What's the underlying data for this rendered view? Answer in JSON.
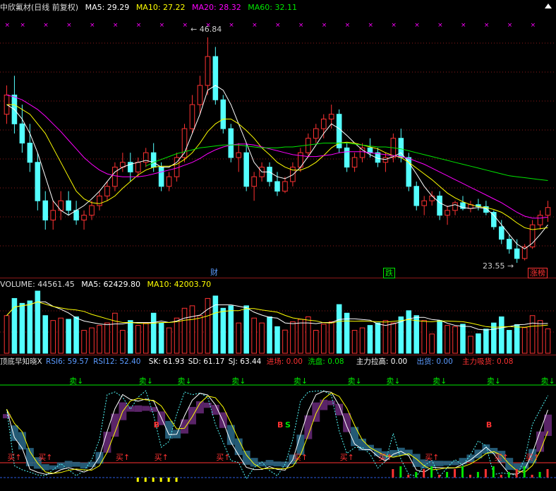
{
  "header": {
    "title": "中欣氟材(日线 前复权)",
    "ma5": "MA5: 29.29",
    "ma10": "MA10: 27.22",
    "ma20": "MA20: 28.32",
    "ma60": "MA60: 32.11"
  },
  "volume_header": {
    "label": "VOLUME: 44561.45",
    "ma5": "MA5: 62429.80",
    "ma10": "MA10: 42003.70"
  },
  "indicator_header": {
    "name": "顶底早知晓X",
    "rsi6": "RSI6: 59.57",
    "rsi12": "RSI12: 52.40",
    "sk": "SK: 61.93",
    "sd": "SD: 61.17",
    "sj": "SJ: 63.44",
    "jinchang": "进场: 0.00",
    "xipan": "洗盘: 0.08",
    "lagao": "主力拉高: 0.00",
    "chuhuo": "出货: 0.00",
    "xihuo": "主力吸货: 0.08"
  },
  "markers": {
    "high_label": "46.84",
    "low_label": "23.55",
    "cai": "财",
    "die": "跌",
    "zhangting": "涨榜",
    "sell": "卖",
    "buy": "买",
    "b_label": "B",
    "s_label": "S",
    "up_arrow": "↑",
    "down_arrow": "↓"
  },
  "colors": {
    "up": "#ff3232",
    "down": "#54ffff",
    "ma5": "#ffffff",
    "ma10": "#ffff00",
    "ma20": "#ff00ff",
    "ma60": "#00e600",
    "grid": "#8b1a1a",
    "purple_area": "#6a2a7a",
    "blue_area": "#2a6a8a"
  },
  "chart_data": {
    "type": "candlestick",
    "title": "中欣氟材(日线 前复权)",
    "price_high": 46.84,
    "price_low": 23.55,
    "candles": [
      [
        39,
        42,
        38,
        41
      ],
      [
        41,
        43,
        37,
        38
      ],
      [
        38,
        40,
        35,
        36
      ],
      [
        36,
        38,
        33,
        34
      ],
      [
        34,
        35,
        29,
        30
      ],
      [
        30,
        31,
        27,
        28
      ],
      [
        28,
        30,
        27,
        29
      ],
      [
        29,
        31,
        28,
        30
      ],
      [
        30,
        31,
        28.5,
        29
      ],
      [
        29,
        30,
        27.5,
        28
      ],
      [
        28,
        29,
        27,
        28.5
      ],
      [
        28.5,
        30,
        28,
        29.5
      ],
      [
        29.5,
        31,
        29,
        30.5
      ],
      [
        30.5,
        32,
        30,
        31.5
      ],
      [
        31.5,
        34,
        31,
        33.5
      ],
      [
        33.5,
        35,
        33,
        34
      ],
      [
        34,
        35,
        32,
        33
      ],
      [
        33,
        34.5,
        32.5,
        34
      ],
      [
        34,
        35.5,
        33.5,
        35
      ],
      [
        35,
        36,
        33,
        33.5
      ],
      [
        33.5,
        34,
        31,
        31.5
      ],
      [
        31.5,
        33,
        31,
        32.5
      ],
      [
        32.5,
        35,
        32,
        34.5
      ],
      [
        34.5,
        38,
        34,
        37.5
      ],
      [
        37.5,
        41,
        37,
        40
      ],
      [
        40,
        43,
        39,
        42
      ],
      [
        42,
        47,
        41,
        45
      ],
      [
        45,
        46,
        40,
        40.5
      ],
      [
        40.5,
        41,
        37,
        37.5
      ],
      [
        37.5,
        38,
        34,
        34.5
      ],
      [
        34.5,
        36,
        33,
        35
      ],
      [
        35,
        36,
        31,
        31.5
      ],
      [
        31.5,
        33,
        30,
        32.5
      ],
      [
        32.5,
        34,
        32,
        33.5
      ],
      [
        33.5,
        34,
        31.5,
        32
      ],
      [
        32,
        33,
        30.5,
        31
      ],
      [
        31,
        32.5,
        30.8,
        32
      ],
      [
        32,
        34,
        31.5,
        33.5
      ],
      [
        33.5,
        35.5,
        33,
        35
      ],
      [
        35,
        37,
        34.5,
        36.5
      ],
      [
        36.5,
        38,
        36,
        37.5
      ],
      [
        37.5,
        39,
        36.5,
        38.5
      ],
      [
        38.5,
        40,
        37.5,
        39
      ],
      [
        39,
        39.5,
        35,
        35.5
      ],
      [
        35.5,
        36,
        33,
        33.5
      ],
      [
        33.5,
        35,
        33,
        34.5
      ],
      [
        34.5,
        36,
        34,
        35.5
      ],
      [
        35.5,
        36.5,
        34.5,
        35
      ],
      [
        35,
        35.5,
        33.5,
        34
      ],
      [
        34,
        35,
        33,
        34.5
      ],
      [
        34.5,
        37,
        34,
        36.5
      ],
      [
        36.5,
        37.5,
        34,
        34.5
      ],
      [
        34.5,
        35,
        31,
        31.5
      ],
      [
        31.5,
        32,
        29,
        29.5
      ],
      [
        29.5,
        30.5,
        28.5,
        30
      ],
      [
        30,
        31,
        29.5,
        30.5
      ],
      [
        30.5,
        31,
        28,
        28.5
      ],
      [
        28.5,
        29.5,
        27.5,
        29
      ],
      [
        29,
        30,
        28.5,
        29.8
      ],
      [
        29.8,
        30.5,
        29,
        29.2
      ],
      [
        29.2,
        30,
        28.8,
        29.6
      ],
      [
        29.6,
        30.2,
        29,
        29.4
      ],
      [
        29.4,
        30,
        28.5,
        28.8
      ],
      [
        28.8,
        29,
        27,
        27.3
      ],
      [
        27.3,
        28,
        25.5,
        26
      ],
      [
        26,
        26.5,
        24.5,
        25
      ],
      [
        25,
        26,
        23.55,
        24
      ],
      [
        24,
        25.5,
        23.8,
        25.2
      ],
      [
        25.2,
        28,
        25,
        27.5
      ],
      [
        27.5,
        29,
        27,
        28.5
      ],
      [
        28.5,
        30,
        27.8,
        29.3
      ]
    ],
    "ma_series": [
      {
        "name": "MA5",
        "color": "#ffffff",
        "values": [
          40,
          39.5,
          38.5,
          37,
          35,
          32.5,
          30,
          29,
          28.5,
          29,
          29.5,
          30.2,
          31,
          32,
          33,
          33.5,
          33.8,
          34,
          34.2,
          34,
          33.5,
          33.5,
          34,
          35,
          37,
          39,
          41.5,
          42,
          41.5,
          40,
          38,
          36,
          34,
          33,
          33,
          32.5,
          32.3,
          32.7,
          33.5,
          34.6,
          35.8,
          37,
          38,
          37.5,
          36.8,
          36,
          35.3,
          34.8,
          34.4,
          34.3,
          34.6,
          35,
          34,
          32.8,
          31.5,
          30.5,
          29.8,
          29.4,
          29.6,
          29.3,
          29.2,
          29.3,
          29.2,
          28.5,
          27.5,
          26.5,
          25.5,
          25,
          25.6,
          26.5,
          27.5
        ]
      },
      {
        "name": "MA10",
        "color": "#ffff00",
        "values": [
          40,
          40,
          39.5,
          39,
          38,
          37,
          35.5,
          34,
          32.5,
          31,
          30.2,
          29.8,
          29.7,
          30,
          30.5,
          31.3,
          32,
          32.7,
          33.2,
          33.5,
          33.6,
          33.6,
          33.8,
          34.3,
          35,
          36,
          37.2,
          38,
          38.5,
          38.5,
          38,
          37.3,
          36.5,
          35.5,
          34.8,
          34,
          33.5,
          33.2,
          33.2,
          33.5,
          34,
          34.7,
          35.5,
          36,
          36.1,
          36,
          35.8,
          35.6,
          35.4,
          35,
          34.7,
          34.5,
          34,
          33.4,
          32.8,
          32.2,
          31.5,
          30.8,
          30.3,
          29.9,
          29.6,
          29.4,
          29.3,
          29.1,
          28.8,
          28.3,
          27.7,
          27.2,
          27,
          27.1,
          27.2
        ]
      },
      {
        "name": "MA20",
        "color": "#ff00ff",
        "values": [
          41,
          40.8,
          40.5,
          40,
          39.5,
          38.8,
          38,
          37.2,
          36.3,
          35.4,
          34.5,
          33.8,
          33.2,
          32.8,
          32.6,
          32.5,
          32.5,
          32.5,
          32.6,
          32.8,
          33,
          33.2,
          33.4,
          33.7,
          34,
          34.4,
          34.9,
          35.3,
          35.6,
          35.8,
          35.9,
          35.9,
          35.8,
          35.6,
          35.4,
          35.2,
          35,
          34.8,
          34.7,
          34.6,
          34.6,
          34.7,
          34.8,
          35,
          35.1,
          35.1,
          35.1,
          35,
          34.9,
          34.8,
          34.7,
          34.6,
          34.4,
          34.1,
          33.8,
          33.4,
          33,
          32.6,
          32.2,
          31.8,
          31.4,
          31,
          30.6,
          30.2,
          29.8,
          29.3,
          28.8,
          28.4,
          28.2,
          28.2,
          28.3
        ]
      },
      {
        "name": "MA60",
        "color": "#00e600",
        "values": [
          null,
          null,
          null,
          null,
          null,
          null,
          null,
          null,
          null,
          null,
          null,
          null,
          null,
          null,
          null,
          null,
          null,
          null,
          33.6,
          34,
          34.3,
          34.6,
          34.9,
          35.1,
          35.3,
          35.5,
          35.6,
          35.7,
          35.8,
          35.8,
          35.8,
          35.7,
          35.6,
          35.5,
          35.5,
          35.5,
          35.6,
          35.6,
          35.7,
          35.8,
          35.9,
          36,
          36,
          36,
          36,
          35.9,
          35.8,
          35.7,
          35.6,
          35.6,
          35.5,
          35.4,
          35.2,
          35,
          34.8,
          34.6,
          34.4,
          34.2,
          34,
          33.8,
          33.6,
          33.4,
          33.2,
          33,
          32.8,
          32.6,
          32.5,
          32.4,
          32.3,
          32.2,
          32.11
        ]
      }
    ],
    "volume_ma5": 62429.8,
    "volume_ma10": 42003.7,
    "volume_last": 44561.45
  }
}
